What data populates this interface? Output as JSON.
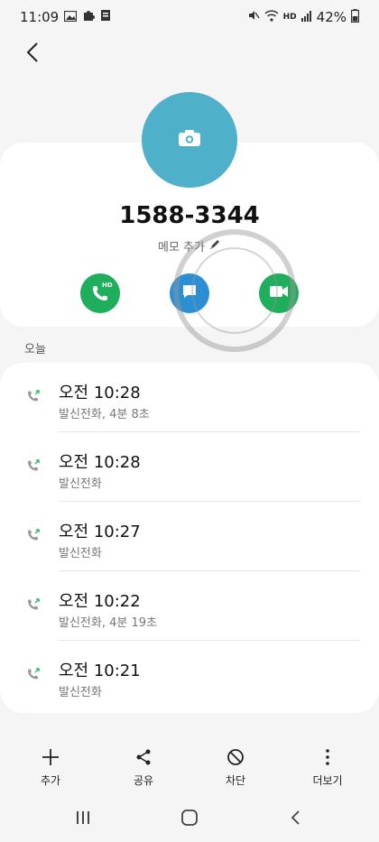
{
  "status_bar": {
    "time": "11:09",
    "battery": "42%",
    "hd_label": "HD"
  },
  "contact": {
    "number": "1588-3344",
    "memo_label": "메모 추가",
    "avatar_color": "#4fb0c9"
  },
  "actions": {
    "call_hd_label": "HD",
    "call_color": "#1fae5b",
    "message_color": "#2c8fd4",
    "video_color": "#1fae5b"
  },
  "section": {
    "today_label": "오늘"
  },
  "call_log": [
    {
      "time": "오전 10:28",
      "detail": "발신전화, 4분 8초",
      "icon": "outgoing-call-icon"
    },
    {
      "time": "오전 10:28",
      "detail": "발신전화",
      "icon": "outgoing-call-icon"
    },
    {
      "time": "오전 10:27",
      "detail": "발신전화",
      "icon": "outgoing-call-icon"
    },
    {
      "time": "오전 10:22",
      "detail": "발신전화, 4분 19초",
      "icon": "outgoing-call-icon"
    },
    {
      "time": "오전 10:21",
      "detail": "발신전화",
      "icon": "outgoing-call-icon"
    }
  ],
  "bottom_bar": {
    "add_label": "추가",
    "share_label": "공유",
    "block_label": "차단",
    "more_label": "더보기"
  }
}
